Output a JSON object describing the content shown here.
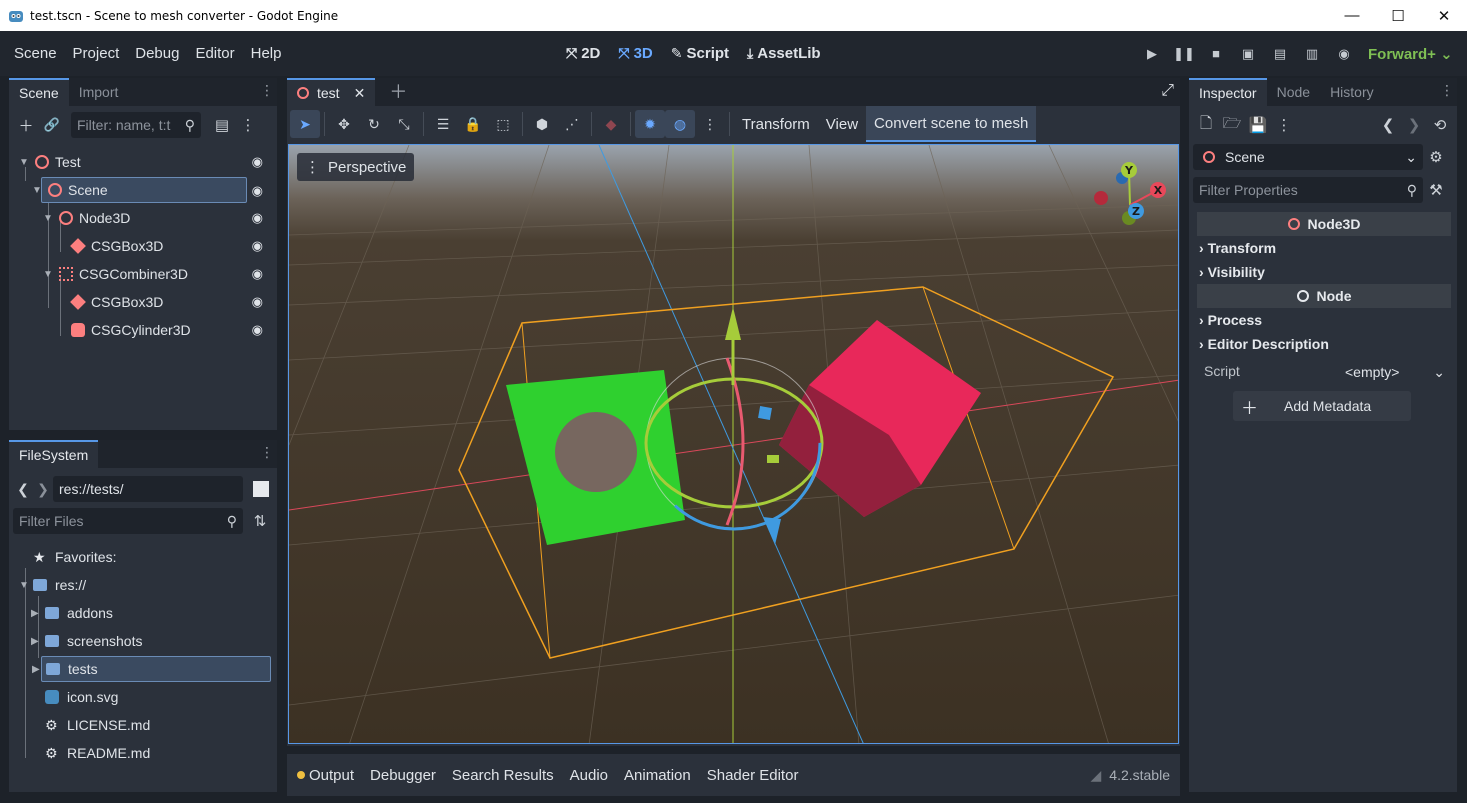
{
  "window": {
    "title": "test.tscn - Scene to mesh converter - Godot Engine",
    "min": "—",
    "max": "☐",
    "close": "✕"
  },
  "menu": [
    "Scene",
    "Project",
    "Debug",
    "Editor",
    "Help"
  ],
  "workspaces": [
    {
      "label": "2D",
      "icon": "⤧"
    },
    {
      "label": "3D",
      "icon": "⤧"
    },
    {
      "label": "Script",
      "icon": "✎"
    },
    {
      "label": "AssetLib",
      "icon": "⤓"
    }
  ],
  "renderer": "Forward+",
  "scene_dock": {
    "tabs": [
      "Scene",
      "Import"
    ],
    "filter_placeholder": "Filter: name, t:t",
    "tree": [
      {
        "label": "Test",
        "depth": 0,
        "icon": "node-ring"
      },
      {
        "label": "Scene",
        "depth": 1,
        "icon": "node-ring",
        "selected": true
      },
      {
        "label": "Node3D",
        "depth": 2,
        "icon": "node-ring"
      },
      {
        "label": "CSGBox3D",
        "depth": 3,
        "icon": "csg-box"
      },
      {
        "label": "CSGCombiner3D",
        "depth": 2,
        "icon": "csg-combiner"
      },
      {
        "label": "CSGBox3D",
        "depth": 3,
        "icon": "csg-box"
      },
      {
        "label": "CSGCylinder3D",
        "depth": 3,
        "icon": "csg-cylinder"
      }
    ]
  },
  "filesystem": {
    "tab": "FileSystem",
    "path": "res://tests/",
    "filter_placeholder": "Filter Files",
    "items": [
      {
        "label": "Favorites:",
        "kind": "favorites"
      },
      {
        "label": "res://",
        "kind": "folder"
      },
      {
        "label": "addons",
        "kind": "folder"
      },
      {
        "label": "screenshots",
        "kind": "folder"
      },
      {
        "label": "tests",
        "kind": "folder",
        "selected": true
      },
      {
        "label": "icon.svg",
        "kind": "file-image"
      },
      {
        "label": "LICENSE.md",
        "kind": "file-doc"
      },
      {
        "label": "README.md",
        "kind": "file-doc"
      }
    ]
  },
  "viewport": {
    "tab": "test",
    "menus": [
      "Transform",
      "View",
      "Convert scene to mesh"
    ],
    "perspective": "Perspective",
    "gizmo_axes": [
      "Y",
      "X",
      "Z"
    ]
  },
  "bottom_tabs": [
    "Output",
    "Debugger",
    "Search Results",
    "Audio",
    "Animation",
    "Shader Editor"
  ],
  "version": "4.2.stable",
  "inspector": {
    "tabs": [
      "Inspector",
      "Node",
      "History"
    ],
    "object": "Scene",
    "filter_placeholder": "Filter Properties",
    "sections": [
      {
        "header": "Node3D",
        "categories": [
          "Transform",
          "Visibility"
        ]
      },
      {
        "header": "Node",
        "categories": [
          "Process",
          "Editor Description"
        ]
      }
    ],
    "script_label": "Script",
    "script_value": "<empty>",
    "add_metadata": "Add Metadata"
  },
  "colors": {
    "accent": "#5797e6",
    "node_red": "#fc7f7f",
    "renderer_green": "#7fbf54"
  }
}
